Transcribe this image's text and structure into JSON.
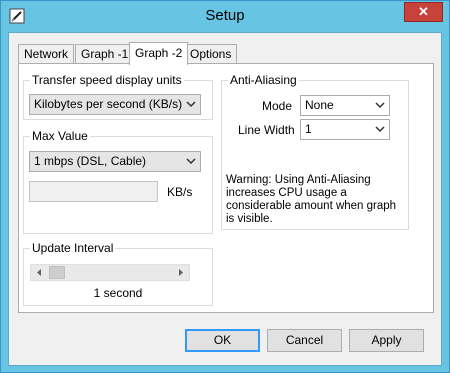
{
  "window": {
    "title": "Setup",
    "close_glyph": "✕"
  },
  "tabs": [
    {
      "label": "Network"
    },
    {
      "label": "Graph -1"
    },
    {
      "label": "Graph -2",
      "selected": true
    },
    {
      "label": "Options"
    }
  ],
  "transfer_speed": {
    "group_label": "Transfer speed display units",
    "selected": "Kilobytes per second (KB/s)"
  },
  "max_value": {
    "group_label": "Max Value",
    "selected": "1 mbps (DSL, Cable)",
    "field_value": "",
    "unit": "KB/s"
  },
  "update_interval": {
    "group_label": "Update Interval",
    "value_text": "1 second",
    "slider_position": 0
  },
  "anti_aliasing": {
    "group_label": "Anti-Aliasing",
    "mode_label": "Mode",
    "mode_value": "None",
    "line_width_label": "Line Width",
    "line_width_value": "1",
    "warning": "Warning: Using Anti-Aliasing increases CPU usage a considerable amount when graph is visible."
  },
  "buttons": {
    "ok": "OK",
    "cancel": "Cancel",
    "apply": "Apply"
  },
  "colors": {
    "title_bar": "#67c4e3",
    "close_button": "#c7423a",
    "default_button_border": "#3399ff"
  },
  "icons": {
    "app": "pencil-icon",
    "close": "close-icon",
    "dropdown": "chevron-down-icon",
    "scroll_left": "arrow-left-icon",
    "scroll_right": "arrow-right-icon"
  }
}
